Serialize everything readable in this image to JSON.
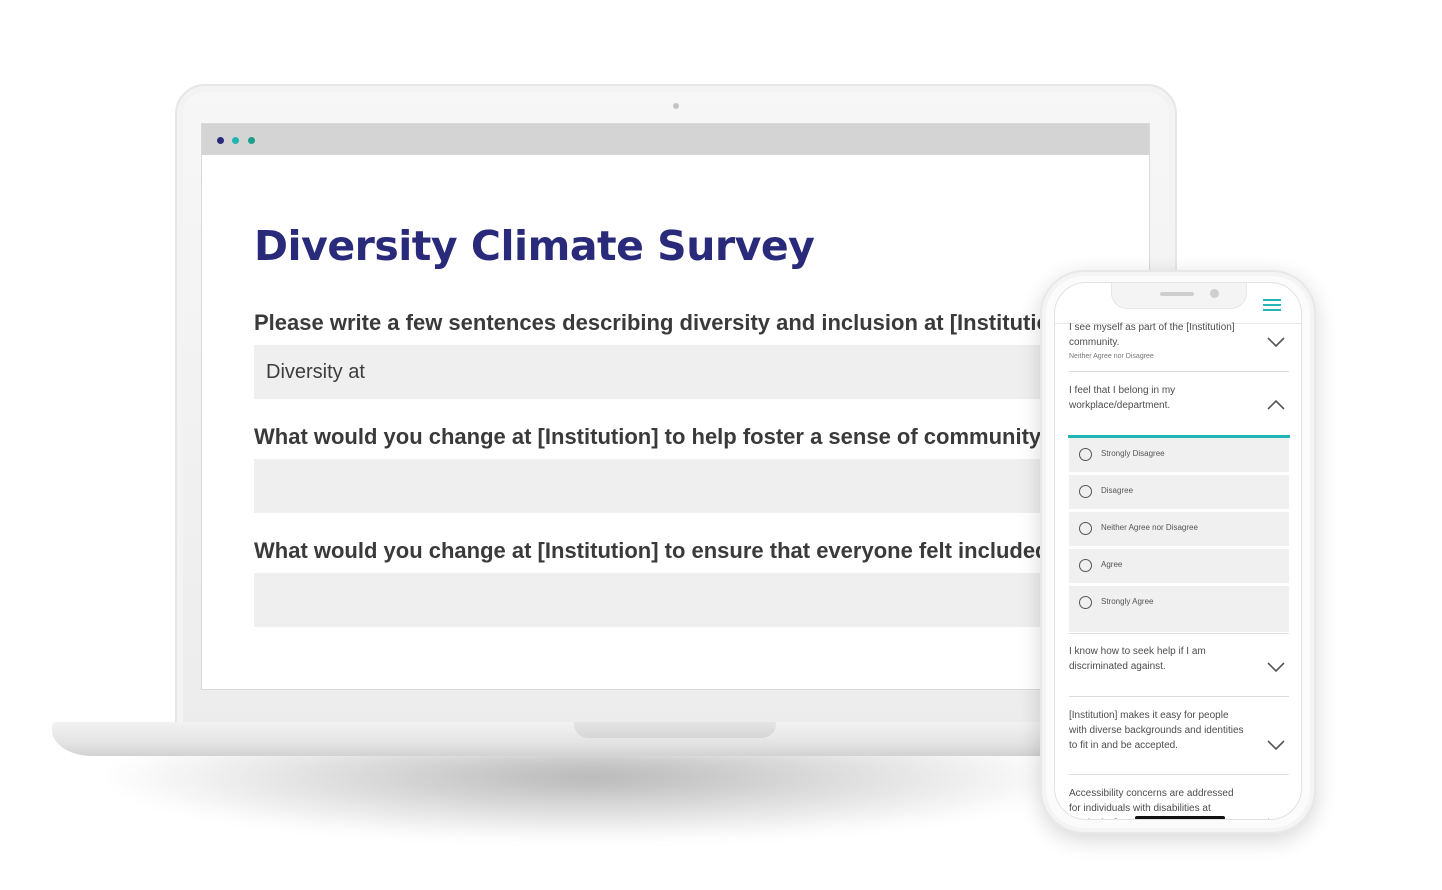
{
  "laptop": {
    "window_dots": [
      "dot-navy",
      "dot-teal",
      "dot-green"
    ],
    "survey_title": "Diversity Climate Survey",
    "questions": [
      {
        "label": "Please write a few sentences describing diversity and inclusion at [Institution]",
        "value": "Diversity at"
      },
      {
        "label": "What would you change at [Institution] to help foster a sense of community?",
        "value": ""
      },
      {
        "label": "What would you change at [Institution] to ensure that everyone felt included?",
        "value": ""
      }
    ]
  },
  "phone": {
    "menu_icon": "hamburger-menu-icon",
    "items": [
      {
        "text": "I see myself as part of the [Institution] community.",
        "selected": "Neither Agree nor Disagree",
        "state": "collapsed"
      },
      {
        "text": "I feel that I belong in my workplace/department.",
        "state": "expanded"
      },
      {
        "text": "I know how to seek help if I am discriminated against.",
        "state": "collapsed"
      },
      {
        "text": "[Institution] makes it easy for people with diverse backgrounds and identities to fit in and be accepted.",
        "state": "collapsed"
      },
      {
        "text": "Accessibility concerns are addressed for individuals with disabilities at [Institution].",
        "state": "collapsed"
      }
    ],
    "options": [
      "Strongly Disagree",
      "Disagree",
      "Neither Agree nor Disagree",
      "Agree",
      "Strongly Agree"
    ]
  },
  "colors": {
    "title": "#2a2a7a",
    "accent_teal": "#21b5b4",
    "input_bg": "#efefef"
  }
}
